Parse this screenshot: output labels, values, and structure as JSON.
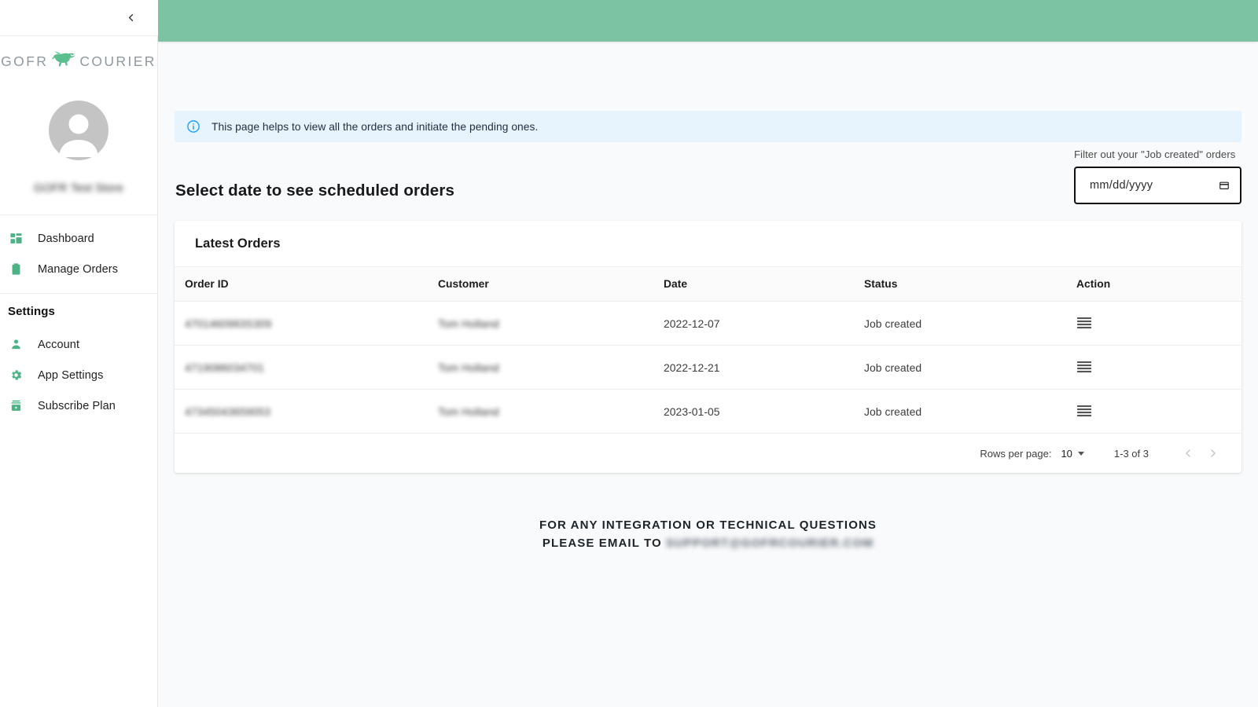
{
  "sidebar": {
    "collapse_icon": "chevron-left-icon",
    "logo": {
      "word_left": "GOFR",
      "word_right": "COURIER",
      "mark_icon": "dinosaur-icon",
      "mark_color": "#5cbd8e"
    },
    "avatar_icon": "user-avatar-icon",
    "store_name": "GOFR Test Store",
    "nav_primary": [
      {
        "label": "Dashboard",
        "icon": "dashboard-icon"
      },
      {
        "label": "Manage Orders",
        "icon": "clipboard-icon"
      }
    ],
    "section_title": "Settings",
    "nav_settings": [
      {
        "label": "Account",
        "icon": "person-icon"
      },
      {
        "label": "App Settings",
        "icon": "gear-icon"
      },
      {
        "label": "Subscribe Plan",
        "icon": "subscription-icon"
      }
    ],
    "accent_color": "#4fb286"
  },
  "header": {
    "bar_color": "#7cc3a2"
  },
  "banner": {
    "icon": "info-circle-icon",
    "text": "This page helps to view all the orders and initiate the pending ones.",
    "bg_color": "#e7f4fd",
    "icon_color": "#1da1f2"
  },
  "page": {
    "heading": "Select date to see scheduled orders"
  },
  "filter": {
    "label": "Filter out your \"Job created\" orders",
    "date_value": "",
    "date_placeholder": "mm/dd/yyyy",
    "calendar_icon": "calendar-icon"
  },
  "table": {
    "title": "Latest Orders",
    "columns": [
      "Order ID",
      "Customer",
      "Date",
      "Status",
      "Action"
    ],
    "rows": [
      {
        "order_id": "4701460983S309",
        "customer": "Tom Holland",
        "date": "2022-12-07",
        "status": "Job created",
        "action_icon": "list-menu-icon"
      },
      {
        "order_id": "4719086034701",
        "customer": "Tom Holland",
        "date": "2022-12-21",
        "status": "Job created",
        "action_icon": "list-menu-icon"
      },
      {
        "order_id": "47345043659053",
        "customer": "Tom Holland",
        "date": "2023-01-05",
        "status": "Job created",
        "action_icon": "list-menu-icon"
      }
    ],
    "pagination": {
      "rows_per_page_label": "Rows per page:",
      "rows_per_page_value": "10",
      "range_label": "1-3 of 3",
      "prev_icon": "chevron-left-icon",
      "next_icon": "chevron-right-icon"
    }
  },
  "footer": {
    "line1": "FOR ANY INTEGRATION OR TECHNICAL QUESTIONS",
    "line2_prefix": "PLEASE EMAIL TO ",
    "email": "SUPPORT@GOFRCOURIER.COM"
  }
}
